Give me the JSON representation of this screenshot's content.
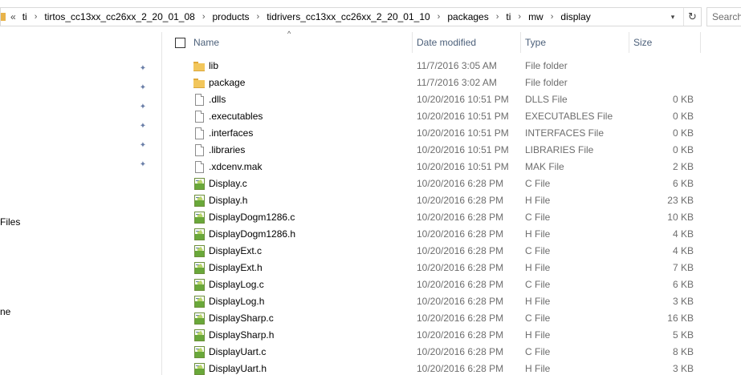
{
  "address": {
    "overflow": "«",
    "crumbs": [
      "ti",
      "tirtos_cc13xx_cc26xx_2_20_01_08",
      "products",
      "tidrivers_cc13xx_cc26xx_2_20_01_10",
      "packages",
      "ti",
      "mw",
      "display"
    ],
    "separator": "›",
    "dropdown_icon": "chevron-down-icon",
    "refresh_icon": "refresh-icon"
  },
  "search": {
    "placeholder": "Search"
  },
  "nav": {
    "partial_labels": [
      "Files",
      "ne"
    ],
    "pinned_count": 6
  },
  "columns": {
    "name": "Name",
    "date": "Date modified",
    "type": "Type",
    "size": "Size"
  },
  "files": [
    {
      "name": "lib",
      "date": "11/7/2016 3:05 AM",
      "type": "File folder",
      "size": "",
      "icon": "folder-icon"
    },
    {
      "name": "package",
      "date": "11/7/2016 3:02 AM",
      "type": "File folder",
      "size": "",
      "icon": "folder-icon"
    },
    {
      "name": ".dlls",
      "date": "10/20/2016 10:51 PM",
      "type": "DLLS File",
      "size": "0 KB",
      "icon": "file-icon"
    },
    {
      "name": ".executables",
      "date": "10/20/2016 10:51 PM",
      "type": "EXECUTABLES File",
      "size": "0 KB",
      "icon": "file-icon"
    },
    {
      "name": ".interfaces",
      "date": "10/20/2016 10:51 PM",
      "type": "INTERFACES File",
      "size": "0 KB",
      "icon": "file-icon"
    },
    {
      "name": ".libraries",
      "date": "10/20/2016 10:51 PM",
      "type": "LIBRARIES File",
      "size": "0 KB",
      "icon": "file-icon"
    },
    {
      "name": ".xdcenv.mak",
      "date": "10/20/2016 10:51 PM",
      "type": "MAK File",
      "size": "2 KB",
      "icon": "file-icon"
    },
    {
      "name": "Display.c",
      "date": "10/20/2016 6:28 PM",
      "type": "C File",
      "size": "6 KB",
      "icon": "source-file-icon"
    },
    {
      "name": "Display.h",
      "date": "10/20/2016 6:28 PM",
      "type": "H File",
      "size": "23 KB",
      "icon": "source-file-icon"
    },
    {
      "name": "DisplayDogm1286.c",
      "date": "10/20/2016 6:28 PM",
      "type": "C File",
      "size": "10 KB",
      "icon": "source-file-icon"
    },
    {
      "name": "DisplayDogm1286.h",
      "date": "10/20/2016 6:28 PM",
      "type": "H File",
      "size": "4 KB",
      "icon": "source-file-icon"
    },
    {
      "name": "DisplayExt.c",
      "date": "10/20/2016 6:28 PM",
      "type": "C File",
      "size": "4 KB",
      "icon": "source-file-icon"
    },
    {
      "name": "DisplayExt.h",
      "date": "10/20/2016 6:28 PM",
      "type": "H File",
      "size": "7 KB",
      "icon": "source-file-icon"
    },
    {
      "name": "DisplayLog.c",
      "date": "10/20/2016 6:28 PM",
      "type": "C File",
      "size": "6 KB",
      "icon": "source-file-icon"
    },
    {
      "name": "DisplayLog.h",
      "date": "10/20/2016 6:28 PM",
      "type": "H File",
      "size": "3 KB",
      "icon": "source-file-icon"
    },
    {
      "name": "DisplaySharp.c",
      "date": "10/20/2016 6:28 PM",
      "type": "C File",
      "size": "16 KB",
      "icon": "source-file-icon"
    },
    {
      "name": "DisplaySharp.h",
      "date": "10/20/2016 6:28 PM",
      "type": "H File",
      "size": "5 KB",
      "icon": "source-file-icon"
    },
    {
      "name": "DisplayUart.c",
      "date": "10/20/2016 6:28 PM",
      "type": "C File",
      "size": "8 KB",
      "icon": "source-file-icon"
    },
    {
      "name": "DisplayUart.h",
      "date": "10/20/2016 6:28 PM",
      "type": "H File",
      "size": "3 KB",
      "icon": "source-file-icon"
    }
  ],
  "colors": {
    "header_text": "#4c607a",
    "secondary_text": "#6d6d6d",
    "folder": "#f2c65b",
    "pin": "#6b7fa8"
  }
}
